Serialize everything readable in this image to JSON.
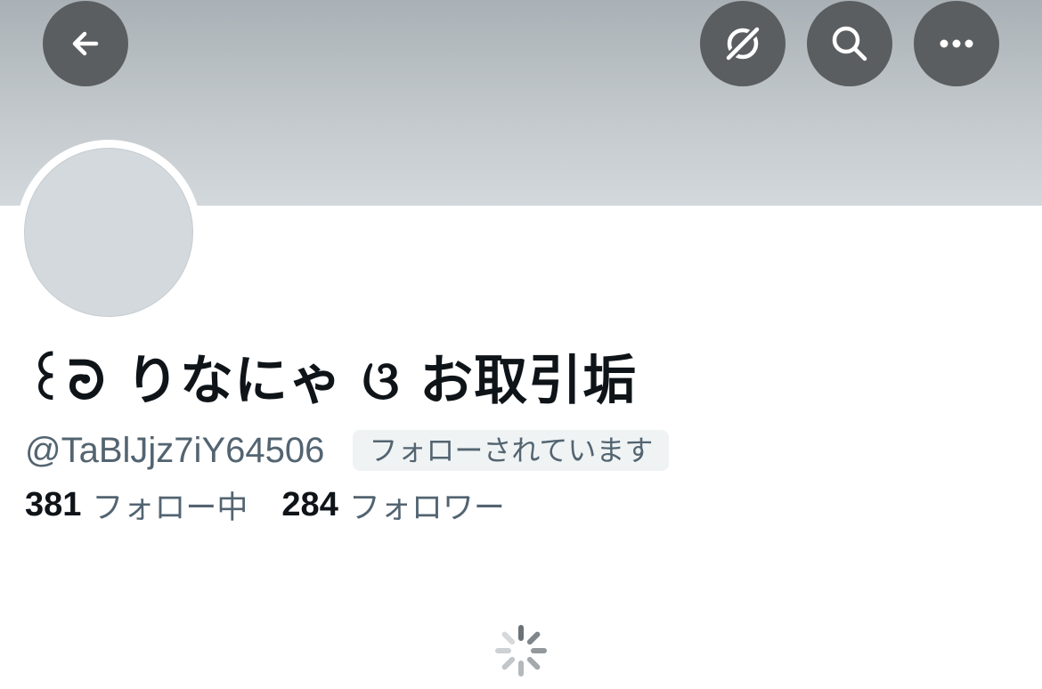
{
  "header": {
    "back_icon": "arrow-left-icon",
    "translate_icon": "translate-icon",
    "search_icon": "search-icon",
    "more_icon": "more-horizontal-icon"
  },
  "profile": {
    "display_name": "꒰ᘒ りなにゃ ଓ お取引垢",
    "handle": "@TaBlJjz7iY64506",
    "follows_you_badge": "フォローされています",
    "following_count": "381",
    "following_label": "フォロー中",
    "followers_count": "284",
    "followers_label": "フォロワー"
  },
  "status": {
    "loading_icon": "loading-spinner-icon"
  },
  "colors": {
    "button_bg": "#5b5e61",
    "banner_top": "#aab1b6",
    "banner_bottom": "#d2d8db",
    "avatar_placeholder": "#d3d9dc",
    "primary_text": "#0f1419",
    "secondary_text": "#536471",
    "badge_bg": "#eff3f4"
  }
}
